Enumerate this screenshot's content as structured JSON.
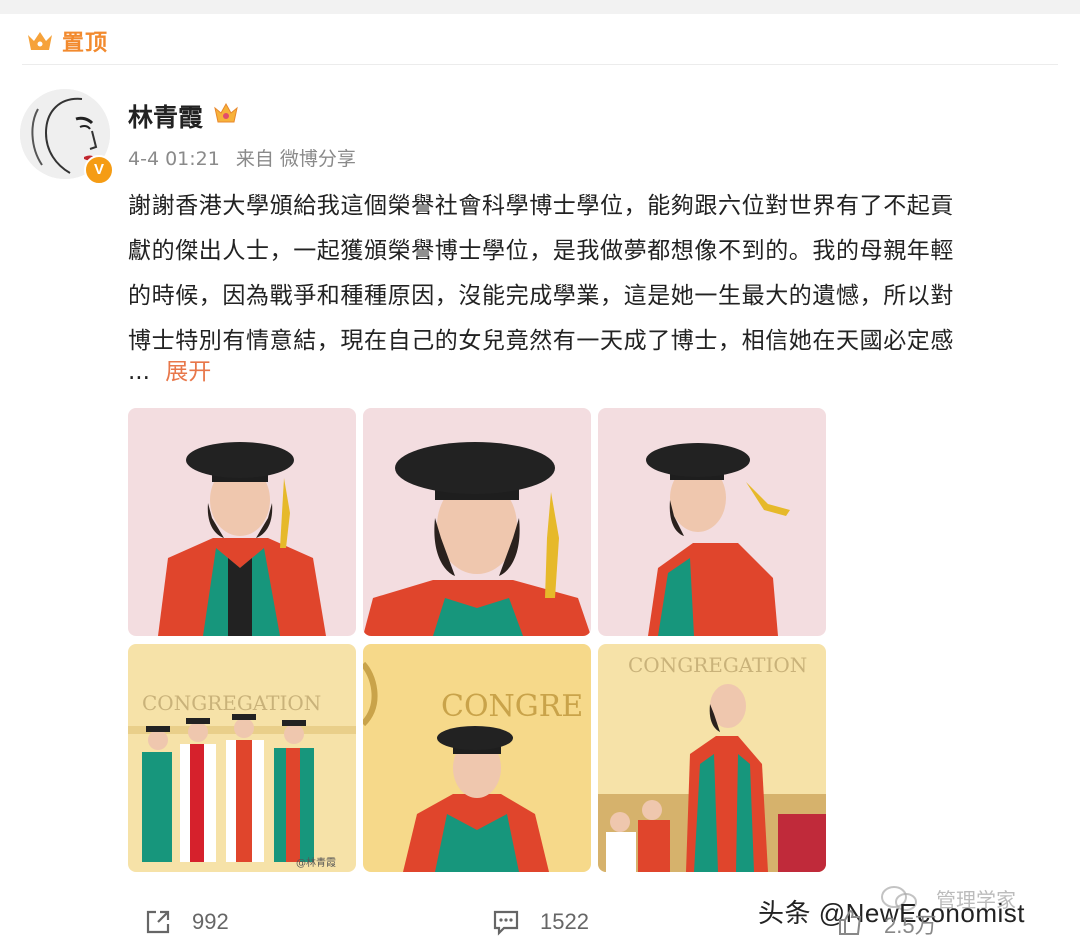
{
  "pinned": {
    "label": "置顶",
    "icon": "crown-icon",
    "color": "#f28a2e"
  },
  "post": {
    "author": "林青霞",
    "verified_badge": "V",
    "timestamp": "4-4 01:21",
    "source": "来自 微博分享",
    "text_lines": [
      "謝謝香港大學頒給我這個榮譽社會科學博士學位，能夠跟六位對世界有了不起貢",
      "獻的傑出人士，一起獲頒榮譽博士學位，是我做夢都想像不到的。我的母親年輕",
      "的時候，因為戰爭和種種原因，沒能完成學業，這是她一生最大的遺憾，所以對",
      "博士特別有情意結，現在自己的女兒竟然有一天成了博士，相信她在天國必定感"
    ],
    "ellipsis": "...",
    "expand_label": "展开",
    "expand_color": "#e8774a",
    "photos": [
      {
        "icon": "photo-1"
      },
      {
        "icon": "photo-2"
      },
      {
        "icon": "photo-3"
      },
      {
        "icon": "photo-4",
        "text": "CONGREGATION"
      },
      {
        "icon": "photo-5",
        "text": "CONGRE"
      },
      {
        "icon": "photo-6",
        "text": "CONGREGATION"
      }
    ],
    "photo_watermark": "@林青霞"
  },
  "actions": {
    "repost_count": "992",
    "comment_count": "1522",
    "like_count": "2.5万"
  },
  "watermarks": {
    "main": "头条 @NewEconomist",
    "secondary": "管理学家"
  }
}
